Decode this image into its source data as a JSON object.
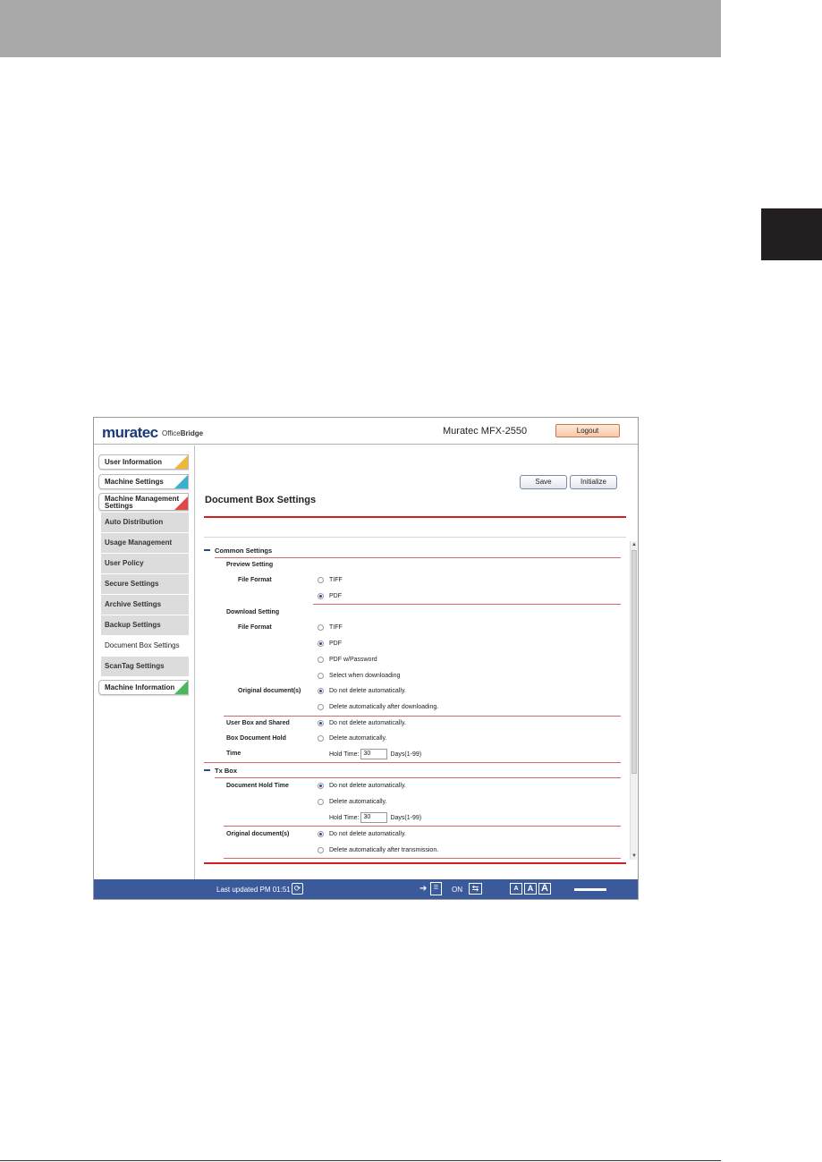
{
  "header": {
    "logo": "muratec",
    "logo_sub_1": "Office",
    "logo_sub_2": "Bridge",
    "model": "Muratec MFX-2550",
    "logout_label": "Logout"
  },
  "sidebar": {
    "main_items": [
      {
        "label": "User Information",
        "color": "#f0b838"
      },
      {
        "label": "Machine Settings",
        "color": "#38b0d0"
      },
      {
        "label": "Machine Management Settings",
        "color": "#e04848"
      },
      {
        "label": "Machine Information",
        "color": "#48b858"
      }
    ],
    "sub_items": [
      {
        "label": "Auto Distribution"
      },
      {
        "label": "Usage Management"
      },
      {
        "label": "User Policy"
      },
      {
        "label": "Secure Settings"
      },
      {
        "label": "Archive Settings"
      },
      {
        "label": "Backup Settings"
      },
      {
        "label": "Document Box Settings"
      },
      {
        "label": "ScanTag Settings"
      }
    ],
    "active_sub": "Document Box Settings"
  },
  "toolbar": {
    "save_label": "Save",
    "initialize_label": "Initialize"
  },
  "page": {
    "title": "Document Box Settings"
  },
  "form": {
    "common_settings": "Common Settings",
    "preview_setting": "Preview Setting",
    "file_format": "File Format",
    "tiff": "TIFF",
    "pdf": "PDF",
    "download_setting": "Download Setting",
    "pdf_password": "PDF w/Password",
    "select_when_downloading": "Select when downloading",
    "original_documents": "Original document(s)",
    "do_not_delete": "Do not delete automatically.",
    "delete_after_downloading": "Delete automatically after downloading.",
    "user_box_shared": "User Box and Shared",
    "box_document_hold": "Box Document Hold",
    "time": "Time",
    "delete_automatically": "Delete automatically.",
    "hold_time_label": "Hold Time:",
    "hold_time_value": "30",
    "days_range": "Days(1-99)",
    "tx_box": "Tx Box",
    "document_hold_time": "Document Hold Time",
    "tx_hold_time_value": "30",
    "delete_after_transmission": "Delete automatically after transmission."
  },
  "status_bar": {
    "last_updated": "Last updated PM 01:51",
    "on_label": "ON",
    "font_sizes": [
      "A",
      "A",
      "A"
    ]
  },
  "colors": {
    "status_bar": "#3a5a9c",
    "accent_red": "#d02020"
  }
}
